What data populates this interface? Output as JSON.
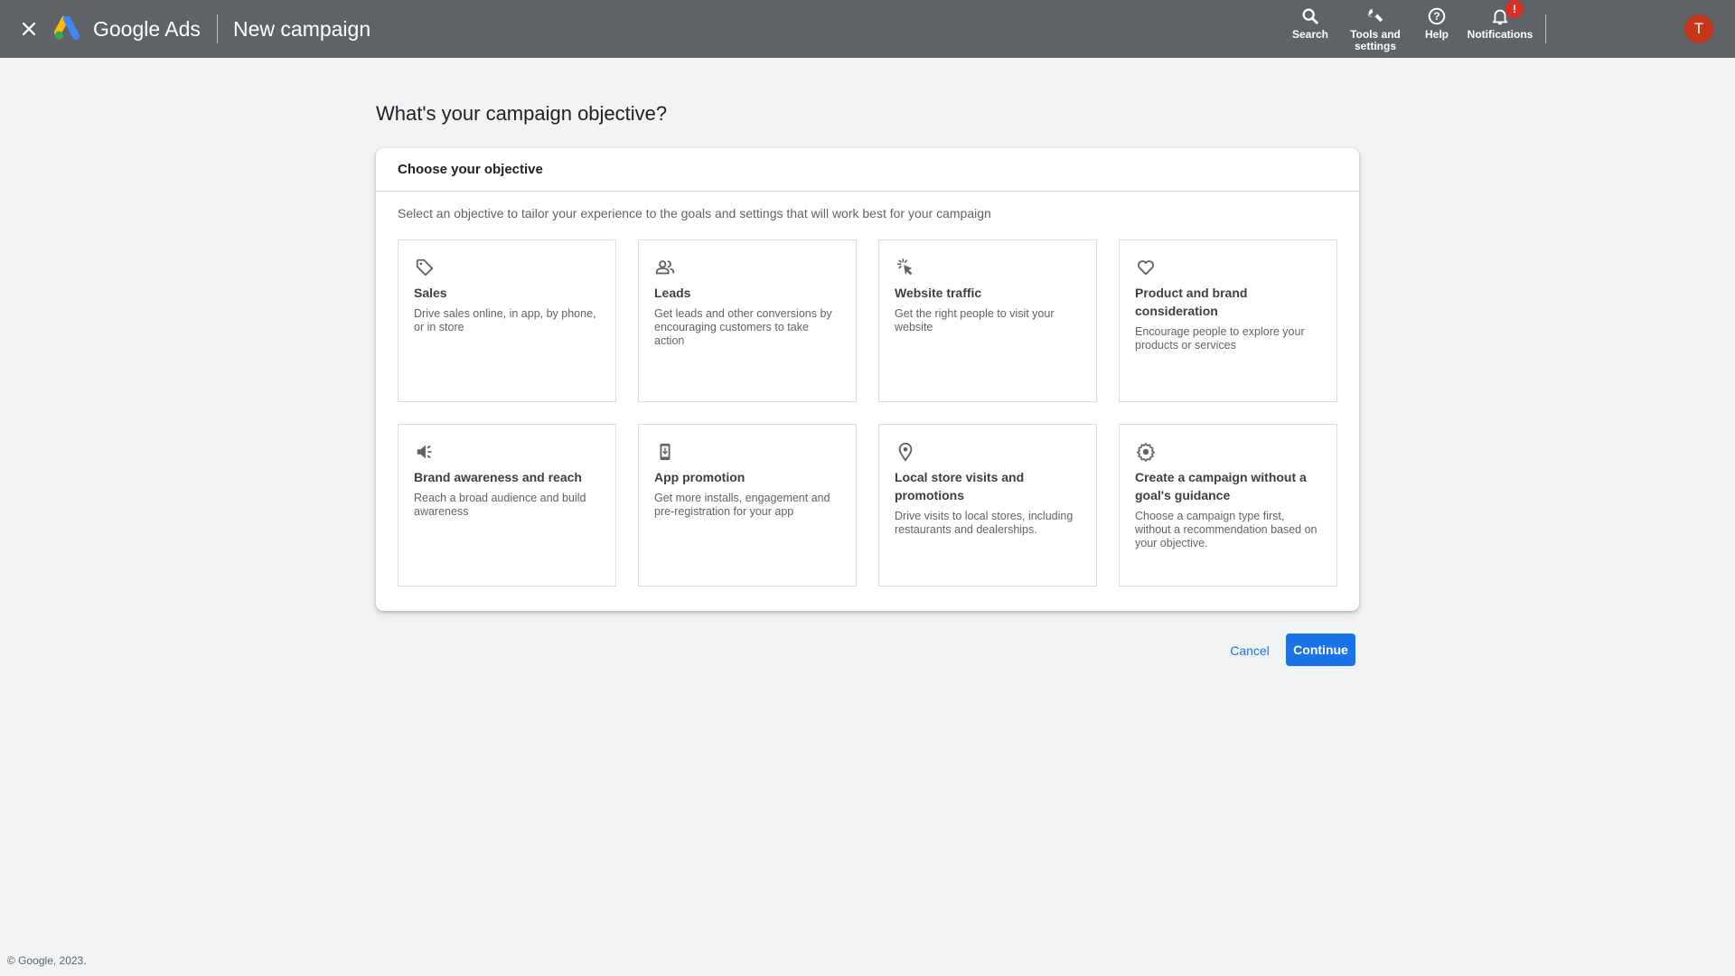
{
  "header": {
    "close_icon": "close-icon",
    "product_name": "Google Ads",
    "page_title": "New campaign",
    "nav": [
      {
        "label": "Search",
        "icon": "search-icon"
      },
      {
        "label": "Tools and settings",
        "icon": "wrench-icon"
      },
      {
        "label": "Help",
        "icon": "help-icon"
      },
      {
        "label": "Notifications",
        "icon": "bell-icon",
        "badge": "!"
      }
    ],
    "avatar_initial": "T",
    "colors": {
      "bar": "#5f6368",
      "avatar": "#c5371a",
      "badge": "#d93025"
    }
  },
  "main": {
    "heading": "What's your campaign objective?",
    "card": {
      "title": "Choose your objective",
      "description": "Select an objective to tailor your experience to the goals and settings that will work best for your campaign",
      "objectives": [
        {
          "title": "Sales",
          "description": "Drive sales online, in app, by phone, or in store",
          "icon": "tag-icon"
        },
        {
          "title": "Leads",
          "description": "Get leads and other conversions by encouraging customers to take action",
          "icon": "people-icon"
        },
        {
          "title": "Website traffic",
          "description": "Get the right people to visit your website",
          "icon": "cursor-click-icon"
        },
        {
          "title": "Product and brand consideration",
          "description": "Encourage people to explore your products or services",
          "icon": "heart-icon"
        },
        {
          "title": "Brand awareness and reach",
          "description": "Reach a broad audience and build awareness",
          "icon": "megaphone-icon"
        },
        {
          "title": "App promotion",
          "description": "Get more installs, engagement and pre-registration for your app",
          "icon": "phone-download-icon"
        },
        {
          "title": "Local store visits and promotions",
          "description": "Drive visits to local stores, including restaurants and dealerships.",
          "icon": "location-pin-icon"
        },
        {
          "title": "Create a campaign without a goal's guidance",
          "description": "Choose a campaign type first, without a recommendation based on your objective.",
          "icon": "gear-icon"
        }
      ]
    },
    "actions": {
      "cancel": "Cancel",
      "continue": "Continue",
      "accent": "#1a73e8"
    }
  },
  "footer": {
    "copyright": "© Google, 2023."
  }
}
